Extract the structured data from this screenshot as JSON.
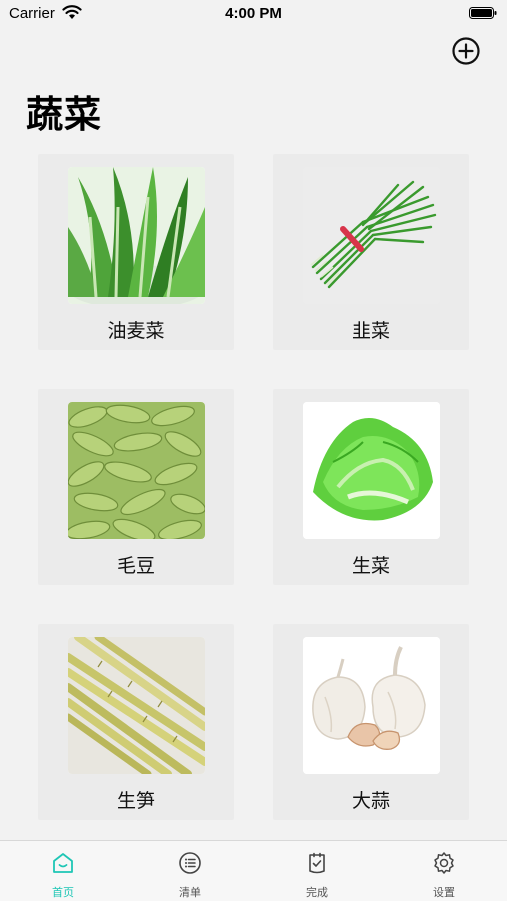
{
  "status_bar": {
    "carrier": "Carrier",
    "time": "4:00 PM"
  },
  "header": {
    "title": "蔬菜",
    "add_icon": "plus-circle-icon"
  },
  "items": [
    {
      "label": "油麦菜",
      "image": "leafy-green-lettuce"
    },
    {
      "label": "韭菜",
      "image": "chives-bundle"
    },
    {
      "label": "毛豆",
      "image": "edamame-pods"
    },
    {
      "label": "生菜",
      "image": "lettuce-head"
    },
    {
      "label": "生笋",
      "image": "bamboo-shoots"
    },
    {
      "label": "大蒜",
      "image": "garlic-bulbs"
    }
  ],
  "tabs": [
    {
      "label": "首页",
      "icon": "home-icon",
      "active": true
    },
    {
      "label": "清单",
      "icon": "list-icon",
      "active": false
    },
    {
      "label": "完成",
      "icon": "check-clipboard-icon",
      "active": false
    },
    {
      "label": "设置",
      "icon": "gear-icon",
      "active": false
    }
  ],
  "colors": {
    "accent": "#1ec6b5",
    "background": "#f2f2f2",
    "card": "#ebebeb"
  }
}
